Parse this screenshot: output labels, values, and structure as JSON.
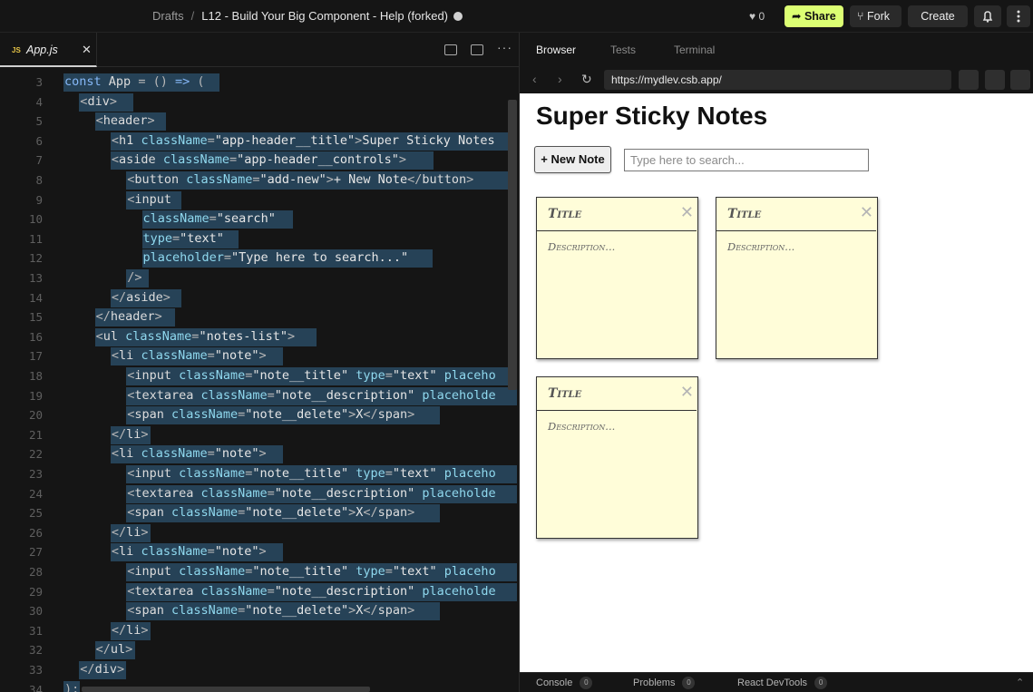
{
  "topbar": {
    "drafts": "Drafts",
    "separator": "/",
    "sandbox_title": "L12 - Build Your Big Component - Help (forked)",
    "likes": "♥ 0",
    "share": "Share",
    "fork": "Fork",
    "create": "Create",
    "accent": "#dcff73"
  },
  "editor": {
    "tab": {
      "badge": "JS",
      "name": "App.js",
      "close": "✕"
    },
    "more": "···",
    "lines": [
      {
        "n": "3",
        "indent": 0,
        "html": "<span class=\"k\">const</span> <span class=\"t\">App</span> <span class=\"p\">=</span> <span class=\"p\">()</span> <span class=\"k\">=&gt;</span> <span class=\"p\">(</span>",
        "hl": 172
      },
      {
        "n": "4",
        "indent": 1,
        "html": "<span class=\"p\">&lt;</span><span class=\"t\">div</span><span class=\"p\">&gt;</span>",
        "hl": 60
      },
      {
        "n": "5",
        "indent": 2,
        "html": "<span class=\"p\">&lt;</span><span class=\"t\">header</span><span class=\"p\">&gt;</span>",
        "hl": 78
      },
      {
        "n": "6",
        "indent": 3,
        "html": "<span class=\"p\">&lt;</span><span class=\"t\">h1</span> <span class=\"a\">className</span><span class=\"p\">=</span><span class=\"s\">\"app-header__title\"</span><span class=\"p\">&gt;</span>Super Sticky Notes",
        "hl": 460
      },
      {
        "n": "7",
        "indent": 3,
        "html": "<span class=\"p\">&lt;</span><span class=\"t\">aside</span> <span class=\"a\">className</span><span class=\"p\">=</span><span class=\"s\">\"app-header__controls\"</span><span class=\"p\">&gt;</span>",
        "hl": 356
      },
      {
        "n": "8",
        "indent": 4,
        "html": "<span class=\"p\">&lt;</span><span class=\"t\">button</span> <span class=\"a\">className</span><span class=\"p\">=</span><span class=\"s\">\"add-new\"</span><span class=\"p\">&gt;</span>+ New Note<span class=\"p\">&lt;/</span><span class=\"t\">button</span><span class=\"p\">&gt;</span>",
        "hl": 422
      },
      {
        "n": "9",
        "indent": 4,
        "html": "<span class=\"p\">&lt;</span><span class=\"t\">input</span>",
        "hl": 61
      },
      {
        "n": "10",
        "indent": 5,
        "html": "<span class=\"a\">className</span><span class=\"p\">=</span><span class=\"s\">\"search\"</span>",
        "hl": 166
      },
      {
        "n": "11",
        "indent": 5,
        "html": "<span class=\"a\">type</span><span class=\"p\">=</span><span class=\"s\">\"text\"</span>",
        "hl": 106
      },
      {
        "n": "12",
        "indent": 5,
        "html": "<span class=\"a\">placeholder</span><span class=\"p\">=</span><span class=\"s\">\"Type here to search...\"</span>",
        "hl": 320
      },
      {
        "n": "13",
        "indent": 4,
        "html": "<span class=\"p\">/&gt;</span>",
        "hl": 25
      },
      {
        "n": "14",
        "indent": 3,
        "html": "<span class=\"p\">&lt;/</span><span class=\"t\">aside</span><span class=\"p\">&gt;</span>",
        "hl": 78
      },
      {
        "n": "15",
        "indent": 2,
        "html": "<span class=\"p\">&lt;/</span><span class=\"t\">header</span><span class=\"p\">&gt;</span>",
        "hl": 88
      },
      {
        "n": "16",
        "indent": 2,
        "html": "<span class=\"p\">&lt;</span><span class=\"t\">ul</span> <span class=\"a\">className</span><span class=\"p\">=</span><span class=\"s\">\"notes-list\"</span><span class=\"p\">&gt;</span>",
        "hl": 244
      },
      {
        "n": "17",
        "indent": 3,
        "html": "<span class=\"p\">&lt;</span><span class=\"t\">li</span> <span class=\"a\">className</span><span class=\"p\">=</span><span class=\"s\">\"note\"</span><span class=\"p\">&gt;</span>",
        "hl": 190
      },
      {
        "n": "18",
        "indent": 4,
        "html": "<span class=\"p\">&lt;</span><span class=\"t\">input</span> <span class=\"a\">className</span><span class=\"p\">=</span><span class=\"s\">\"note__title\"</span> <span class=\"a\">type</span><span class=\"p\">=</span><span class=\"s\">\"text\"</span> <span class=\"a\">placeho</span>",
        "hl": 432
      },
      {
        "n": "19",
        "indent": 4,
        "html": "<span class=\"p\">&lt;</span><span class=\"t\">textarea</span> <span class=\"a\">className</span><span class=\"p\">=</span><span class=\"s\">\"note__description\"</span> <span class=\"a\">placeholde</span>",
        "hl": 432
      },
      {
        "n": "20",
        "indent": 4,
        "html": "<span class=\"p\">&lt;</span><span class=\"t\">span</span> <span class=\"a\">className</span><span class=\"p\">=</span><span class=\"s\">\"note__delete\"</span><span class=\"p\">&gt;</span>X<span class=\"p\">&lt;/</span><span class=\"t\">span</span><span class=\"p\">&gt;</span>",
        "hl": 346
      },
      {
        "n": "21",
        "indent": 3,
        "html": "<span class=\"p\">&lt;/</span><span class=\"t\">li</span><span class=\"p\">&gt;</span>",
        "hl": 44
      },
      {
        "n": "22",
        "indent": 3,
        "html": "<span class=\"p\">&lt;</span><span class=\"t\">li</span> <span class=\"a\">className</span><span class=\"p\">=</span><span class=\"s\">\"note\"</span><span class=\"p\">&gt;</span>",
        "hl": 190
      },
      {
        "n": "23",
        "indent": 4,
        "html": "<span class=\"p\">&lt;</span><span class=\"t\">input</span> <span class=\"a\">className</span><span class=\"p\">=</span><span class=\"s\">\"note__title\"</span> <span class=\"a\">type</span><span class=\"p\">=</span><span class=\"s\">\"text\"</span> <span class=\"a\">placeho</span>",
        "hl": 432
      },
      {
        "n": "24",
        "indent": 4,
        "html": "<span class=\"p\">&lt;</span><span class=\"t\">textarea</span> <span class=\"a\">className</span><span class=\"p\">=</span><span class=\"s\">\"note__description\"</span> <span class=\"a\">placeholde</span>",
        "hl": 432
      },
      {
        "n": "25",
        "indent": 4,
        "html": "<span class=\"p\">&lt;</span><span class=\"t\">span</span> <span class=\"a\">className</span><span class=\"p\">=</span><span class=\"s\">\"note__delete\"</span><span class=\"p\">&gt;</span>X<span class=\"p\">&lt;/</span><span class=\"t\">span</span><span class=\"p\">&gt;</span>",
        "hl": 346
      },
      {
        "n": "26",
        "indent": 3,
        "html": "<span class=\"p\">&lt;/</span><span class=\"t\">li</span><span class=\"p\">&gt;</span>",
        "hl": 44
      },
      {
        "n": "27",
        "indent": 3,
        "html": "<span class=\"p\">&lt;</span><span class=\"t\">li</span> <span class=\"a\">className</span><span class=\"p\">=</span><span class=\"s\">\"note\"</span><span class=\"p\">&gt;</span>",
        "hl": 190
      },
      {
        "n": "28",
        "indent": 4,
        "html": "<span class=\"p\">&lt;</span><span class=\"t\">input</span> <span class=\"a\">className</span><span class=\"p\">=</span><span class=\"s\">\"note__title\"</span> <span class=\"a\">type</span><span class=\"p\">=</span><span class=\"s\">\"text\"</span> <span class=\"a\">placeho</span>",
        "hl": 432
      },
      {
        "n": "29",
        "indent": 4,
        "html": "<span class=\"p\">&lt;</span><span class=\"t\">textarea</span> <span class=\"a\">className</span><span class=\"p\">=</span><span class=\"s\">\"note__description\"</span> <span class=\"a\">placeholde</span>",
        "hl": 432
      },
      {
        "n": "30",
        "indent": 4,
        "html": "<span class=\"p\">&lt;</span><span class=\"t\">span</span> <span class=\"a\">className</span><span class=\"p\">=</span><span class=\"s\">\"note__delete\"</span><span class=\"p\">&gt;</span>X<span class=\"p\">&lt;/</span><span class=\"t\">span</span><span class=\"p\">&gt;</span>",
        "hl": 346
      },
      {
        "n": "31",
        "indent": 3,
        "html": "<span class=\"p\">&lt;/</span><span class=\"t\">li</span><span class=\"p\">&gt;</span>",
        "hl": 44
      },
      {
        "n": "32",
        "indent": 2,
        "html": "<span class=\"p\">&lt;/</span><span class=\"t\">ul</span><span class=\"p\">&gt;</span>",
        "hl": 44
      },
      {
        "n": "33",
        "indent": 1,
        "html": "<span class=\"p\">&lt;/</span><span class=\"t\">div</span><span class=\"p\">&gt;</span>",
        "hl": 52
      },
      {
        "n": "34",
        "indent": 0,
        "html": "<span class=\"p\">);</span>",
        "hl": 18
      }
    ]
  },
  "browser": {
    "tabs": [
      "Browser",
      "Tests",
      "Terminal"
    ],
    "url": "https://mydlev.csb.app/",
    "app_title": "Super Sticky Notes",
    "new_note_label": "+ New Note",
    "search_placeholder": "Type here to search...",
    "notes": [
      {
        "title": "Title",
        "description": "Description...",
        "delete": "✕"
      },
      {
        "title": "Title",
        "description": "Description...",
        "delete": "✕"
      },
      {
        "title": "Title",
        "description": "Description...",
        "delete": "✕"
      }
    ],
    "note_color": "#fffdd9"
  },
  "bottombar": [
    {
      "label": "Console",
      "count": "0"
    },
    {
      "label": "Problems",
      "count": "0"
    },
    {
      "label": "React DevTools",
      "count": "0"
    }
  ]
}
